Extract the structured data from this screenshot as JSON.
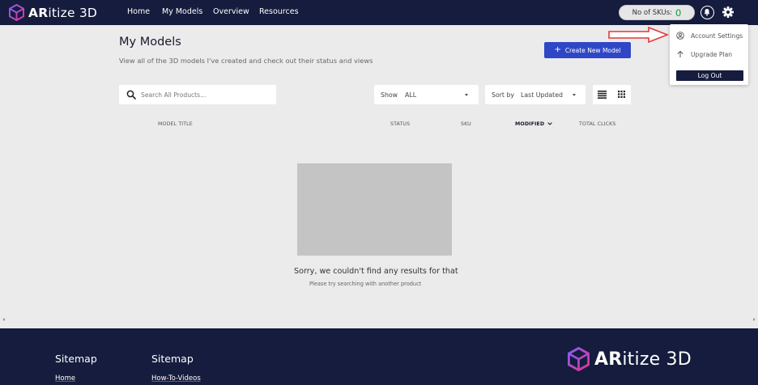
{
  "brand": {
    "name_bold": "AR",
    "name_rest": "itize 3D"
  },
  "nav": {
    "links": [
      "Home",
      "My Models",
      "Overview",
      "Resources"
    ],
    "sku_label": "No of SKUs:",
    "sku_count": "0"
  },
  "header": {
    "title": "My Models",
    "subtitle": "View all of the 3D models I've created and check out their status and views",
    "create_button": "Create New Model"
  },
  "filters": {
    "search_placeholder": "Search All Products...",
    "show_label": "Show",
    "show_value": "ALL",
    "sort_label": "Sort by",
    "sort_value": "Last Updated"
  },
  "table": {
    "columns": [
      "MODEL TITLE",
      "STATUS",
      "SKU",
      "MODIFIED",
      "TOTAL CLICKS"
    ]
  },
  "empty_state": {
    "title": "Sorry, we couldn't find any results for that",
    "subtitle": "Please try searching with another product"
  },
  "user_menu": {
    "items": [
      "Account Settings",
      "Upgrade Plan"
    ],
    "logout": "Log Out"
  },
  "footer": {
    "columns": [
      {
        "heading": "Sitemap",
        "link": "Home"
      },
      {
        "heading": "Sitemap",
        "link": "How-To-Videos"
      }
    ]
  },
  "colors": {
    "navy": "#151c3d",
    "primary_button": "#2f47c7",
    "sku_green": "#0c9b3a",
    "annotation_arrow": "#e53935"
  }
}
